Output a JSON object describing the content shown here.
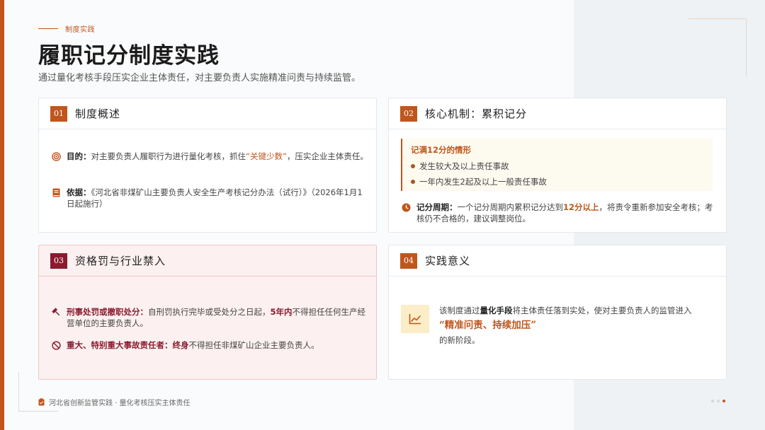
{
  "header": {
    "kicker": "制度实践",
    "title": "履职记分制度实践",
    "subtitle": "通过量化考核手段压实企业主体责任，对主要负责人实施精准问责与持续监管。"
  },
  "colors": {
    "accent": "#c0561c",
    "deep_red": "#8a1a2e",
    "callout_bg": "#fdfaf0"
  },
  "cards": [
    {
      "num": "01",
      "title": "制度概述",
      "items": [
        {
          "icon": "target-icon",
          "label": "目的：",
          "text_pre": "对主要负责人履职行为进行量化考核，抓住",
          "highlight": "“关键少数”",
          "text_post": "，压实企业主体责任。"
        },
        {
          "icon": "book-icon",
          "label": "依据：",
          "text": "《河北省非煤矿山主要负责人安全生产考核记分办法（试行）》（2026年1月1日起施行）"
        }
      ]
    },
    {
      "num": "02",
      "title": "核心机制：累积记分",
      "callout_title": "记满12分的情形",
      "callout_items": [
        "发生较大及以上责任事故",
        "一年内发生2起及以上一般责任事故"
      ],
      "period": {
        "icon": "clock-icon",
        "label": "记分周期：",
        "text_pre": "一个记分周期内累积记分达到",
        "highlight": "12分以上",
        "text_post": "，将责令重新参加安全考核；考核仍不合格的，建议调整岗位。"
      }
    },
    {
      "num": "03",
      "title": "资格罚与行业禁入",
      "items": [
        {
          "icon": "hammer-icon",
          "label": "刑事处罚或撤职处分：",
          "text_pre": "自刑罚执行完毕或受处分之日起，",
          "highlight": "5年内",
          "text_post": "不得担任任何生产经营单位的主要负责人。"
        },
        {
          "icon": "ban-icon",
          "label": "重大、特别重大事故责任者：",
          "highlight": "终身",
          "text_post": "不得担任非煤矿山企业主要负责人。"
        }
      ]
    },
    {
      "num": "04",
      "title": "实践意义",
      "icon": "chart-line-icon",
      "text_pre": "该制度通过",
      "highlight": "量化手段",
      "text_mid": "将主体责任落到实处，使对主要负责人的监管进入",
      "quote": "“精准问责、持续加压”",
      "text_post": "的新阶段。"
    }
  ],
  "footer": {
    "icon": "clipboard-icon",
    "text": "河北省创新监管实践 · 量化考核压实主体责任"
  },
  "pagination": {
    "count": 3,
    "active": 3
  }
}
